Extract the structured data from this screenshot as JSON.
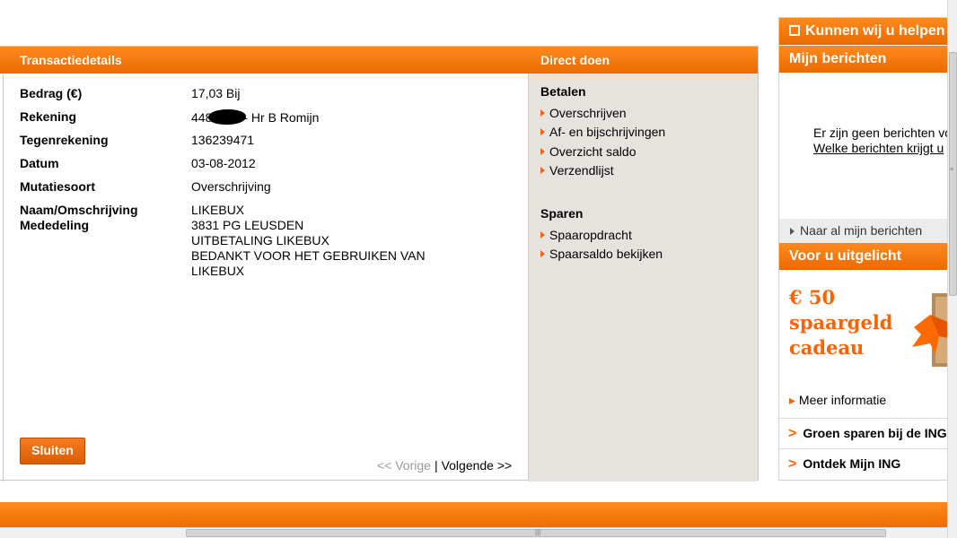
{
  "transaction": {
    "header_title": "Transactiedetails",
    "fields": [
      {
        "label": "Bedrag (€)",
        "value": "17,03 Bij"
      },
      {
        "label": "Rekening",
        "value_prefix": "448",
        "value_suffix": "- Hr B Romijn"
      },
      {
        "label": "Tegenrekening",
        "value": "136239471"
      },
      {
        "label": "Datum",
        "value": "03-08-2012"
      },
      {
        "label": "Mutatiesoort",
        "value": "Overschrijving"
      },
      {
        "label": "Naam/Omschrijving",
        "label2": "Mededeling",
        "value_lines": [
          "LIKEBUX",
          "3831 PG LEUSDEN",
          "UITBETALING LIKEBUX",
          "BEDANKT VOOR HET GEBRUIKEN VAN",
          "LIKEBUX"
        ]
      }
    ],
    "close_label": "Sluiten",
    "pager": {
      "prev": "<< Vorige",
      "separator": "|",
      "next": "Volgende >>"
    }
  },
  "direct_doen": {
    "header_title": "Direct doen",
    "sections": [
      {
        "title": "Betalen",
        "links": [
          "Overschrijven",
          "Af- en bijschrijvingen",
          "Overzicht saldo",
          "Verzendlijst"
        ]
      },
      {
        "title": "Sparen",
        "links": [
          "Spaaropdracht",
          "Spaarsaldo bekijken"
        ]
      }
    ]
  },
  "right_column": {
    "help_title": "Kunnen wij u helpen",
    "messages_title": "Mijn berichten",
    "messages_empty": "Er zijn geen berichten vo",
    "messages_link": "Welke berichten krijgt u",
    "messages_all": "Naar al mijn berichten",
    "promo_title": "Voor u uitgelicht",
    "promo_lines": [
      "€ 50",
      "spaargeld",
      "cadeau"
    ],
    "more_info": "Meer informatie",
    "links": [
      "Groen sparen bij de ING",
      "Ontdek Mijn ING"
    ]
  },
  "colors": {
    "accent": "#ff6200",
    "sidebar_bg": "#e6e3df"
  }
}
